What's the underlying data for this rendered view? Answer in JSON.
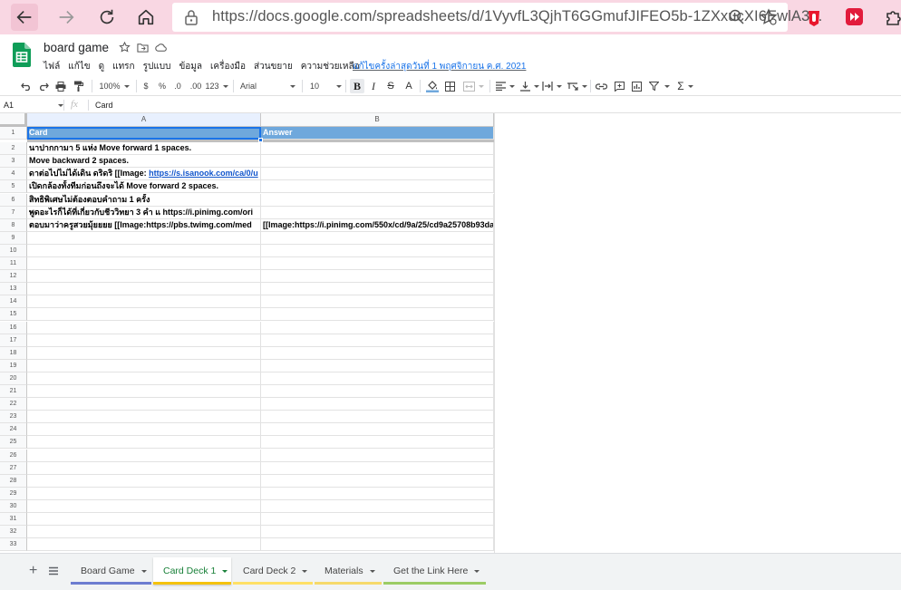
{
  "browser": {
    "url": "https://docs.google.com/spreadsheets/d/1VyvfL3QjhT6GGmufJIFEO5b-1ZXxucXI6EwlA3..."
  },
  "doc": {
    "title": "board game",
    "menu": [
      "ไฟล์",
      "แก้ไข",
      "ดู",
      "แทรก",
      "รูปแบบ",
      "ข้อมูล",
      "เครื่องมือ",
      "ส่วนขยาย",
      "ความช่วยเหลือ"
    ],
    "last_edit": "แก้ไขครั้งล่าสุดวันที่ 1 พฤศจิกายน ค.ศ. 2021"
  },
  "toolbar": {
    "zoom": "100%",
    "currency": "$",
    "percent": "%",
    "dec_decrease": ".0",
    "dec_increase": ".00",
    "more_formats": "123",
    "font": "Arial",
    "font_size": "10",
    "bold": "B",
    "italic": "I",
    "strike": "S",
    "text_color": "A",
    "functions": "Σ"
  },
  "formula_bar": {
    "name_box": "A1",
    "fx": "fx",
    "content": "Card"
  },
  "grid": {
    "columns": [
      "A",
      "B"
    ],
    "row_numbers": [
      "1",
      "2",
      "3",
      "4",
      "5",
      "6",
      "7",
      "8",
      "9",
      "10",
      "11",
      "12",
      "13",
      "14",
      "15",
      "16",
      "17",
      "18",
      "19",
      "20",
      "21",
      "22",
      "23",
      "24",
      "25",
      "26",
      "27",
      "28",
      "29",
      "30",
      "31",
      "32",
      "33"
    ],
    "header": [
      "Card",
      "Answer"
    ],
    "rows": [
      [
        "นาปากกามา 5 แห่ง                  Move forward 1 spaces.",
        ""
      ],
      [
        " Move backward 2 spaces.",
        ""
      ],
      [
        "ดาต่อไปไม่ได้เดิน ดริดริ  [[Image: ",
        ""
      ],
      [
        "เปิดกล้องทั้งทีมก่อนถึงจะได้       Move forward 2 spaces.",
        ""
      ],
      [
        "สิทธิพิเศษไม่ต้องตอบคำถาม 1 ครั้ง",
        ""
      ],
      [
        "พูดอะไรก็ได้ที่เกี่ยวกับชีววิทยา 3 คำ  แ https://i.pinimg.com/ori",
        ""
      ],
      [
        "ตอบมาว่าครูสวยมุ้ยยยย   [[Image:https://pbs.twimg.com/med",
        "[[Image:https://i.pinimg.com/550x/cd/9a/25/cd9a25708b93da"
      ]
    ],
    "row4_link": "https://s.isanook.com/ca/0/u"
  },
  "sheets": [
    "Board Game",
    "Card Deck 1",
    "Card Deck 2",
    "Materials",
    "Get the Link Here"
  ],
  "colors": {
    "browser_bg": "#f9d7e3",
    "header_fill": "#6fa8dc",
    "active_tab": "#188038"
  }
}
